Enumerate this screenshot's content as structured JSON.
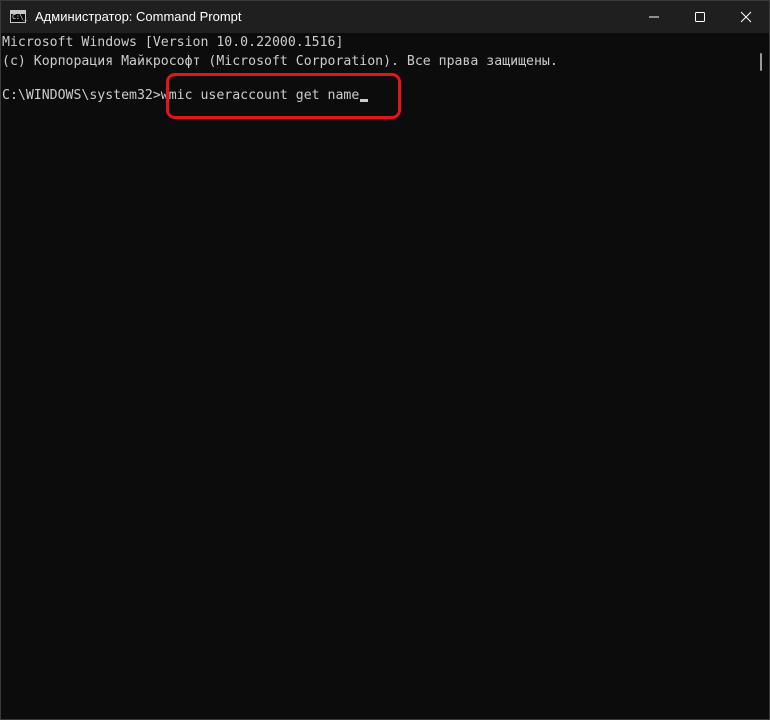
{
  "window": {
    "title": "Администратор: Command Prompt",
    "icon_text": "C:\\_"
  },
  "controls": {
    "minimize": "minimize-icon",
    "maximize": "maximize-icon",
    "close": "close-icon"
  },
  "console": {
    "lines": [
      "Microsoft Windows [Version 10.0.22000.1516]",
      "(c) Корпорация Майкрософт (Microsoft Corporation). Все права защищены.",
      "C:\\WINDOWS\\system32>wmic useraccount get name"
    ]
  },
  "colors": {
    "background": "#0c0c0c",
    "titlebar": "#1f1f1f",
    "text": "#cccccc",
    "highlight": "#e5141b"
  }
}
